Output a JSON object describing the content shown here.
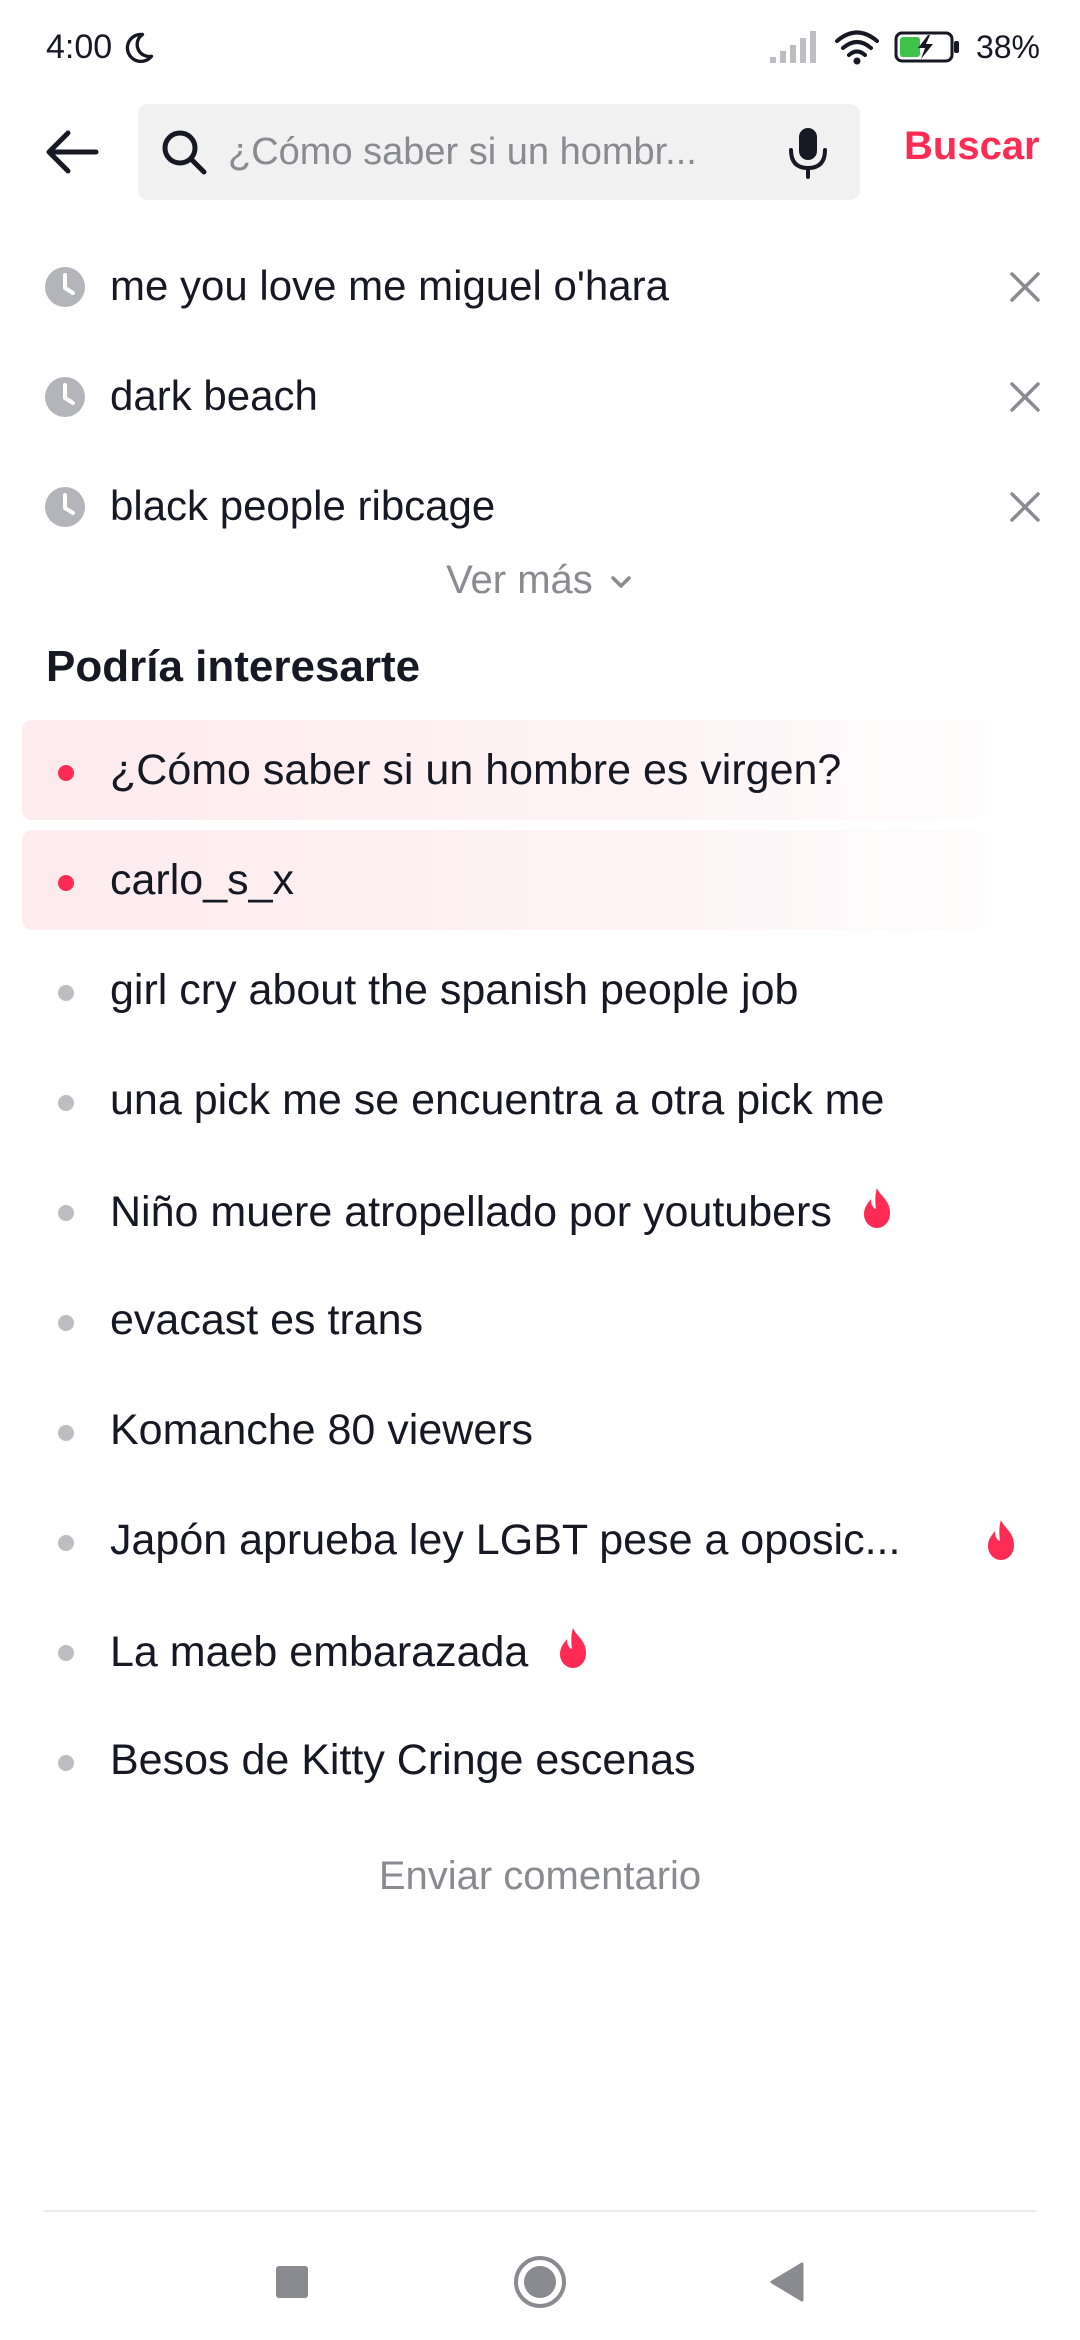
{
  "status_bar": {
    "time": "4:00",
    "battery": "38%"
  },
  "search": {
    "placeholder": "¿Cómo saber si un hombr...",
    "submit_label": "Buscar"
  },
  "history": {
    "items": [
      {
        "label": "me you love me miguel o'hara"
      },
      {
        "label": "dark beach"
      },
      {
        "label": "black people ribcage"
      }
    ],
    "see_more_label": "Ver más"
  },
  "suggestions": {
    "title": "Podría interesarte",
    "items": [
      {
        "label": "¿Cómo saber si un hombre es virgen?",
        "highlighted": true,
        "hot": false
      },
      {
        "label": "carlo_s_x",
        "highlighted": true,
        "hot": false
      },
      {
        "label": "girl cry about the spanish people job",
        "highlighted": false,
        "hot": false
      },
      {
        "label": "una pick me se encuentra a otra pick me",
        "highlighted": false,
        "hot": false
      },
      {
        "label": "Niño muere atropellado por youtubers",
        "highlighted": false,
        "hot": true
      },
      {
        "label": "evacast es trans",
        "highlighted": false,
        "hot": false
      },
      {
        "label": "Komanche 80 viewers",
        "highlighted": false,
        "hot": false
      },
      {
        "label": "Japón aprueba ley LGBT pese a oposic...",
        "highlighted": false,
        "hot": true
      },
      {
        "label": "La maeb embarazada",
        "highlighted": false,
        "hot": true
      },
      {
        "label": "Besos de Kitty Cringe escenas",
        "highlighted": false,
        "hot": false
      }
    ]
  },
  "feedback_label": "Enviar comentario",
  "colors": {
    "accent": "#fe2c55",
    "text": "#161823",
    "muted": "#8a8b91"
  }
}
